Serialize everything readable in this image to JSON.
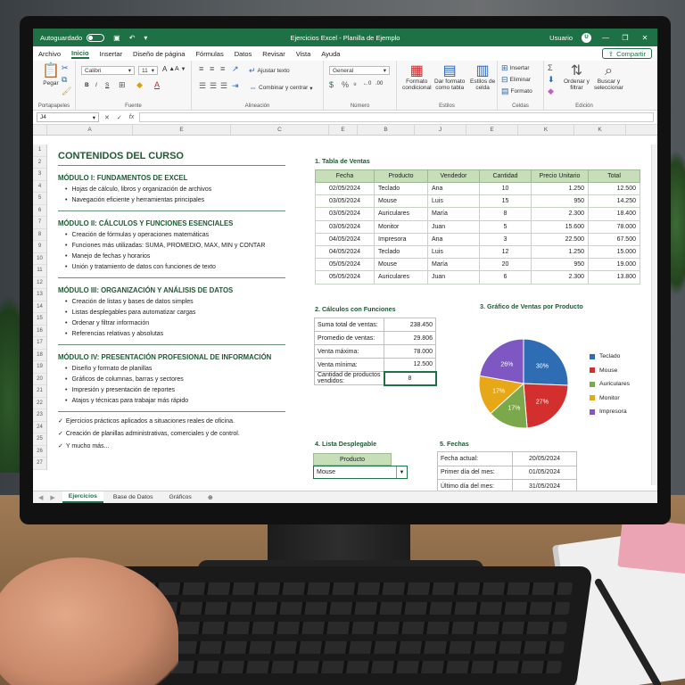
{
  "window": {
    "autosave_label": "Autoguardado",
    "title": "Ejercicios Excel - Planilla de Ejemplo",
    "user_label": "Usuario",
    "user_initial": "U"
  },
  "menu": {
    "tabs": [
      "Archivo",
      "Inicio",
      "Insertar",
      "Diseño de página",
      "Fórmulas",
      "Datos",
      "Revisar",
      "Vista",
      "Ayuda"
    ],
    "active_tab": "Inicio",
    "share_label": "Compartir"
  },
  "ribbon": {
    "portapapeles": {
      "label": "Portapapeles",
      "paste": "Pegar"
    },
    "fuente": {
      "label": "Fuente",
      "font": "Calibri",
      "size": "11"
    },
    "alineacion": {
      "label": "Alineación",
      "wrap": "Ajustar texto",
      "merge": "Combinar y centrar"
    },
    "numero": {
      "label": "Número",
      "format": "General"
    },
    "estilos": {
      "label": "Estilos",
      "conditional_1": "Formato",
      "conditional_2": "condicional",
      "table_1": "Dar formato",
      "table_2": "como tabla",
      "cell_1": "Estilos de",
      "cell_2": "celda"
    },
    "celdas": {
      "label": "Celdas",
      "insert": "Insertar",
      "delete": "Eliminar",
      "format": "Formato"
    },
    "edicion": {
      "label": "Edición",
      "sort_1": "Ordenar y",
      "sort_2": "filtrar",
      "find_1": "Buscar y",
      "find_2": "seleccionar"
    }
  },
  "formula_bar": {
    "cell_ref": "J4",
    "fx": "fx",
    "value": ""
  },
  "columns": [
    "A",
    "E",
    "C",
    "E",
    "B",
    "J",
    "E",
    "K",
    "K"
  ],
  "rows": [
    "1",
    "2",
    "3",
    "4",
    "5",
    "6",
    "7",
    "8",
    "9",
    "10",
    "11",
    "12",
    "13",
    "14",
    "15",
    "16",
    "17",
    "18",
    "19",
    "20",
    "21",
    "22",
    "23",
    "24",
    "25",
    "26",
    "27"
  ],
  "course": {
    "title": "CONTENIDOS DEL CURSO",
    "modules": [
      {
        "title": "MÓDULO I: FUNDAMENTOS DE EXCEL",
        "items": [
          "Hojas de cálculo, libros y organización de archivos",
          "Navegación eficiente y herramientas principales"
        ]
      },
      {
        "title": "MÓDULO II: CÁLCULOS Y FUNCIONES ESENCIALES",
        "items": [
          "Creación de fórmulas y operaciones matemáticas",
          "Funciones más utilizadas: SUMA, PROMEDIO, MAX, MIN y CONTAR",
          "Manejo de fechas y horarios",
          "Unión y tratamiento de datos con funciones de texto"
        ]
      },
      {
        "title": "MÓDULO III: ORGANIZACIÓN Y ANÁLISIS DE DATOS",
        "items": [
          "Creación de listas y bases de datos simples",
          "Listas desplegables para automatizar cargas",
          "Ordenar y filtrar información",
          "Referencias relativas y absolutas"
        ]
      },
      {
        "title": "MÓDULO IV: PRESENTACIÓN PROFESIONAL DE INFORMACIÓN",
        "items": [
          "Diseño y formato de planillas",
          "Gráficos de columnas, barras y sectores",
          "Impresión y presentación de reportes",
          "Atajos y técnicas para trabajar más rápido"
        ]
      }
    ],
    "extras": [
      "Ejercicios prácticos aplicados a situaciones reales de oficina.",
      "Creación de planillas administrativas, comerciales y de control.",
      "Y mucho más..."
    ]
  },
  "sales_table": {
    "title": "1. Tabla de Ventas",
    "headers": [
      "Fecha",
      "Producto",
      "Vendedor",
      "Cantidad",
      "Precio Unitario",
      "Total"
    ],
    "rows": [
      [
        "02/05/2024",
        "Teclado",
        "Ana",
        "10",
        "1.250",
        "12.500"
      ],
      [
        "03/05/2024",
        "Mouse",
        "Luis",
        "15",
        "950",
        "14.250"
      ],
      [
        "03/05/2024",
        "Auriculares",
        "María",
        "8",
        "2.300",
        "18.400"
      ],
      [
        "03/05/2024",
        "Monitor",
        "Juan",
        "5",
        "15.600",
        "78.000"
      ],
      [
        "04/05/2024",
        "Impresora",
        "Ana",
        "3",
        "22.500",
        "67.500"
      ],
      [
        "04/05/2024",
        "Teclado",
        "Luis",
        "12",
        "1.250",
        "15.000"
      ],
      [
        "05/05/2024",
        "Mouse",
        "María",
        "20",
        "950",
        "19.000"
      ],
      [
        "05/05/2024",
        "Auriculares",
        "Juan",
        "6",
        "2.300",
        "13.800"
      ]
    ]
  },
  "calculations": {
    "title": "2. Cálculos con Funciones",
    "rows": [
      {
        "label": "Suma total de ventas:",
        "value": "238.450"
      },
      {
        "label": "Promedio de ventas:",
        "value": "29.806"
      },
      {
        "label": "Venta máxima:",
        "value": "78.000"
      },
      {
        "label": "Venta mínima:",
        "value": "12.500"
      },
      {
        "label": "Cantidad de productos vendidos:",
        "value": "8"
      }
    ]
  },
  "chart_data": {
    "type": "pie",
    "title": "3. Gráfico de Ventas por Producto",
    "categories": [
      "Teclado",
      "Mouse",
      "Auriculares",
      "Monitor",
      "Impresora"
    ],
    "values": [
      30,
      27,
      17,
      17,
      26
    ],
    "value_labels": [
      "30%",
      "27%",
      "17%",
      "17%",
      "26%"
    ],
    "colors": [
      "#2e6db4",
      "#d32f2f",
      "#7aa84a",
      "#e6a817",
      "#7e57c2"
    ],
    "legend_position": "right"
  },
  "dropdown": {
    "title": "4. Lista Desplegable",
    "header": "Producto",
    "value": "Mouse"
  },
  "dates": {
    "title": "5. Fechas",
    "rows": [
      {
        "label": "Fecha actual:",
        "value": "20/05/2024"
      },
      {
        "label": "Primer día del mes:",
        "value": "01/05/2024"
      },
      {
        "label": "Último día del mes:",
        "value": "31/05/2024"
      }
    ]
  },
  "sheet_tabs": [
    "Ejercicios",
    "Base de Datos",
    "Gráficos"
  ],
  "active_sheet": "Ejercicios"
}
